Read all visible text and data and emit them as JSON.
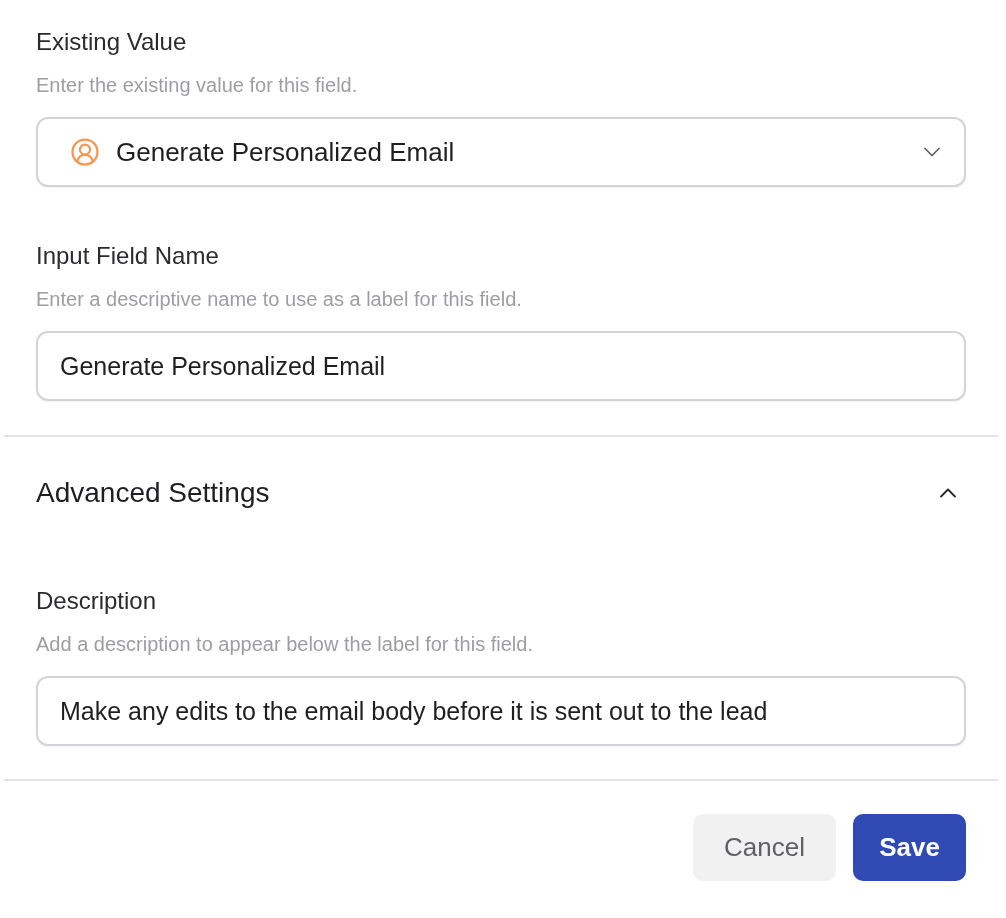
{
  "fields": [
    {
      "kind": "select",
      "label": "Existing Value",
      "hint": "Enter the existing value for this field.",
      "value": "Generate Personalized Email"
    },
    {
      "kind": "text",
      "label": "Input Field Name",
      "hint": "Enter a descriptive name to use as a label for this field.",
      "value": "Generate Personalized Email"
    }
  ],
  "advanced": {
    "title": "Advanced Settings",
    "expanded": true,
    "fields": [
      {
        "kind": "text",
        "label": "Description",
        "hint": "Add a description to appear below the label for this field.",
        "value": "Make any edits to the email body before it is sent out to the lead"
      }
    ]
  },
  "buttons": [
    {
      "label": "Cancel",
      "kind": "secondary"
    },
    {
      "label": "Save",
      "kind": "primary"
    }
  ]
}
